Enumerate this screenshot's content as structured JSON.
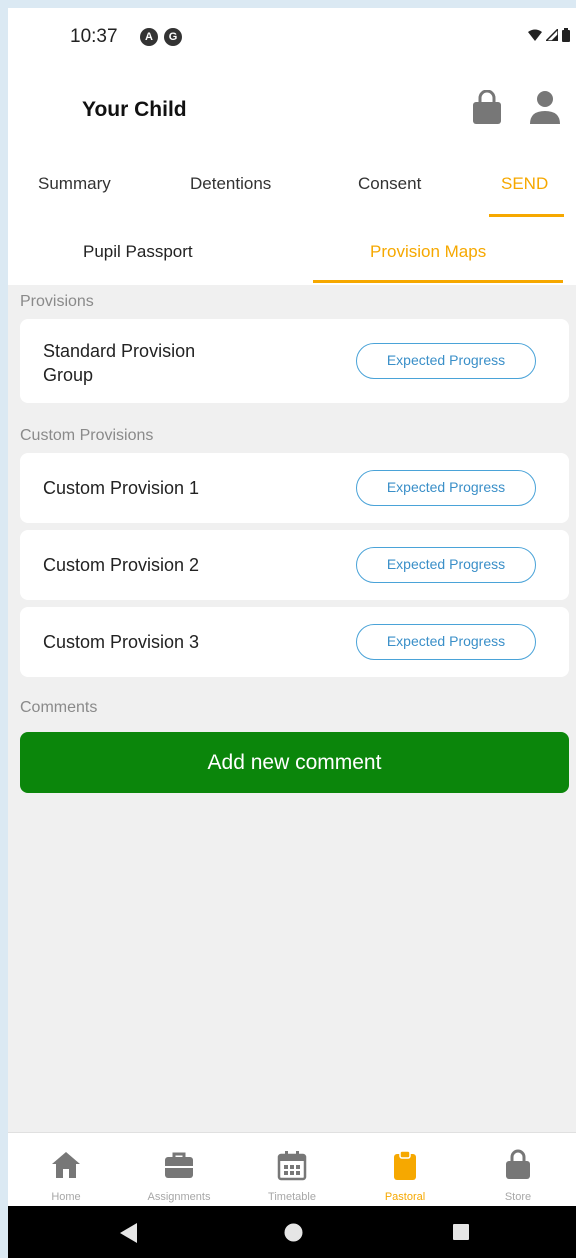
{
  "status_bar": {
    "time": "10:37",
    "dot1": "A",
    "dot2": "G"
  },
  "header": {
    "title": "Your Child"
  },
  "tabs": [
    {
      "label": "Summary"
    },
    {
      "label": "Detentions"
    },
    {
      "label": "Consent"
    },
    {
      "label": "SEND",
      "active": true
    }
  ],
  "subtabs": [
    {
      "label": "Pupil Passport"
    },
    {
      "label": "Provision Maps",
      "active": true
    }
  ],
  "provisions": {
    "section_label": "Provisions",
    "items": [
      {
        "name": "Standard Provision Group",
        "status": "Expected Progress"
      }
    ]
  },
  "custom_provisions": {
    "section_label": "Custom Provisions",
    "items": [
      {
        "name": "Custom Provision 1",
        "status": "Expected Progress"
      },
      {
        "name": "Custom Provision 2",
        "status": "Expected Progress"
      },
      {
        "name": "Custom Provision 3",
        "status": "Expected Progress"
      }
    ]
  },
  "comments": {
    "section_label": "Comments",
    "add_button": "Add new comment"
  },
  "bottom_nav": [
    {
      "label": "Home",
      "icon": "home-icon"
    },
    {
      "label": "Assignments",
      "icon": "briefcase-icon"
    },
    {
      "label": "Timetable",
      "icon": "calendar-icon"
    },
    {
      "label": "Pastoral",
      "icon": "clipboard-icon",
      "active": true
    },
    {
      "label": "Store",
      "icon": "shopping-bag-icon"
    }
  ],
  "colors": {
    "accent": "#f6a800",
    "pill": "#4aa3d8",
    "button": "#0b860b"
  }
}
